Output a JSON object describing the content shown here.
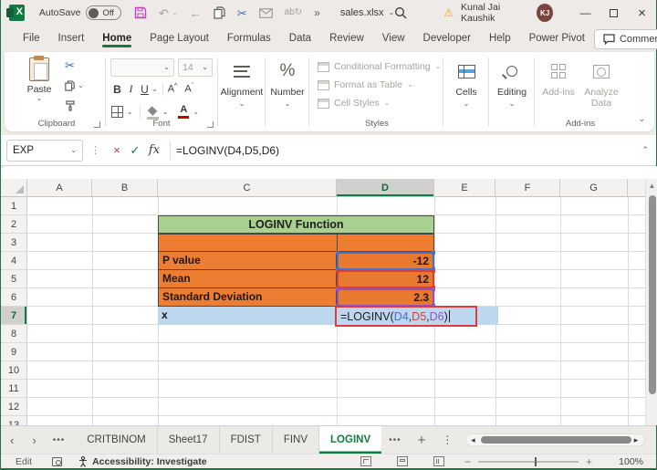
{
  "titlebar": {
    "app": "Excel",
    "autosave_label": "AutoSave",
    "autosave_state": "Off",
    "more": "»",
    "file_name": "sales.xlsx",
    "user_name": "Kunal Jai Kaushik",
    "user_initials": "KJ"
  },
  "menubar": {
    "tabs": [
      "File",
      "Insert",
      "Home",
      "Page Layout",
      "Formulas",
      "Data",
      "Review",
      "View",
      "Developer",
      "Help",
      "Power Pivot"
    ],
    "active_tab": "Home",
    "comments": "Comments"
  },
  "ribbon": {
    "paste": "Paste",
    "clipboard_group": "Clipboard",
    "font_group": "Font",
    "font_size": "14",
    "bold": "B",
    "italic": "I",
    "underline": "U",
    "grow_font": "A",
    "shrink_font": "A",
    "font_color": "A",
    "alignment": "Alignment",
    "number": "Number",
    "percent": "%",
    "styles_items": [
      "Conditional Formatting",
      "Format as Table",
      "Cell Styles"
    ],
    "styles_group": "Styles",
    "cells": "Cells",
    "editing": "Editing",
    "addins": "Add-ins",
    "analyze": "Analyze Data",
    "addins_group": "Add-ins"
  },
  "formula_bar": {
    "name_box": "EXP",
    "formula": "=LOGINV(D4,D5,D6)"
  },
  "grid": {
    "columns": [
      "A",
      "B",
      "C",
      "D",
      "E",
      "F",
      "G"
    ],
    "active_column": "D",
    "rows": [
      "1",
      "2",
      "3",
      "4",
      "5",
      "6",
      "7",
      "8",
      "9",
      "10",
      "11",
      "12",
      "13"
    ],
    "active_row": "7"
  },
  "table": {
    "title": "LOGINV Function",
    "rows": [
      {
        "label": "P value",
        "value": "-12",
        "color": "#4472C4"
      },
      {
        "label": "Mean",
        "value": "12",
        "color": "#D44239"
      },
      {
        "label": "Standard Deviation",
        "value": "2.3",
        "color": "#9256BE"
      }
    ],
    "x_label": "x",
    "formula_parts": [
      {
        "text": "=LOGINV(",
        "color": "#1F1F1F"
      },
      {
        "text": "D4",
        "color": "#4472C4"
      },
      {
        "text": ",",
        "color": "#1F1F1F"
      },
      {
        "text": "D5",
        "color": "#D44239"
      },
      {
        "text": ",",
        "color": "#1F1F1F"
      },
      {
        "text": "D6",
        "color": "#9256BE"
      },
      {
        "text": ")",
        "color": "#1F1F1F"
      }
    ]
  },
  "sheet_tabs": {
    "tabs": [
      "CRITBINOM",
      "Sheet17",
      "FDIST",
      "FINV"
    ],
    "active": "LOGINV"
  },
  "status_bar": {
    "mode": "Edit",
    "accessibility": "Accessibility: Investigate",
    "zoom_level": "100%"
  },
  "colors": {
    "accent_green": "#217346",
    "table_header_green": "#A9D08E",
    "table_orange": "#ED7D31",
    "row_highlight_blue": "#BDD7EE",
    "edit_border_red": "#DD3C3C",
    "ref_blue": "#4472C4",
    "ref_red": "#D44239",
    "ref_purple": "#9256BE"
  }
}
